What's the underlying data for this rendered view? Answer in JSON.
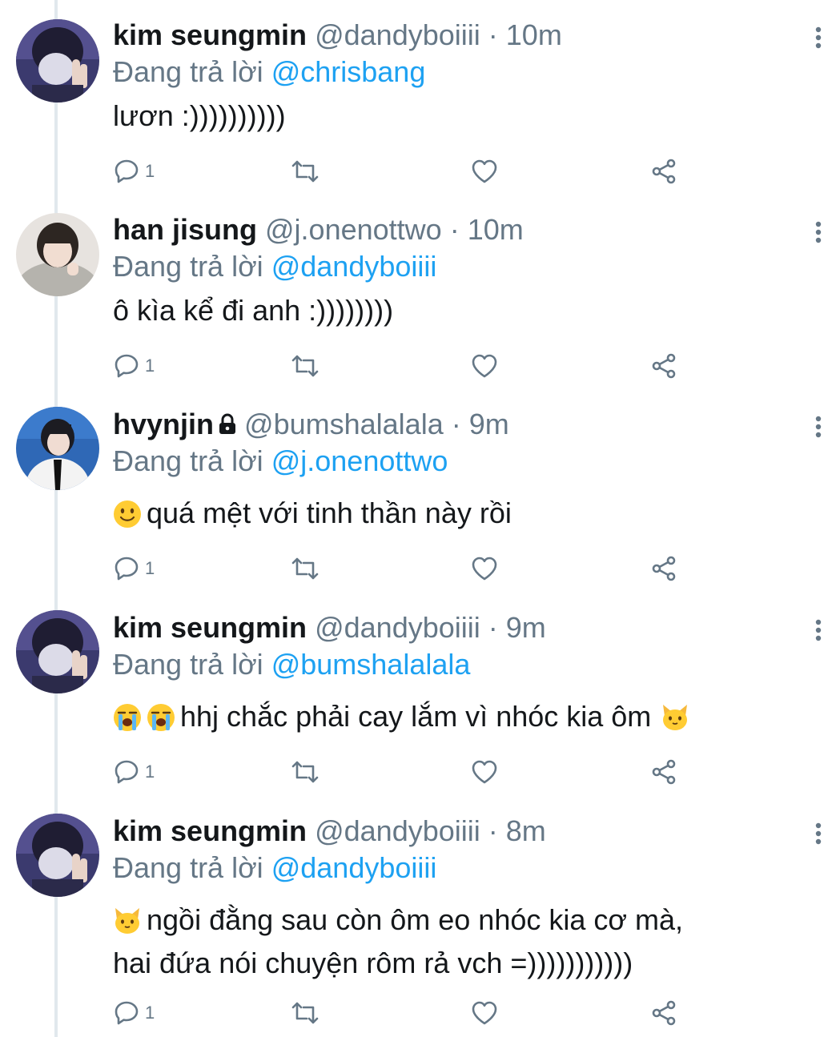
{
  "colors": {
    "link": "#1da1f2",
    "secondary_text": "#657786",
    "primary_text": "#14171a",
    "thread_line": "#e1e8ed"
  },
  "tweets": [
    {
      "name": "kim seungmin",
      "handle": "@dandyboiiii",
      "time": "10m",
      "reply_prefix": "Đang trả lời",
      "reply_to": "@chrisbang",
      "text_lines": [
        "lươn :))))))))))"
      ],
      "reply_count": "1",
      "locked": false,
      "avatar_icon": "avatar-masked-photo"
    },
    {
      "name": "han jisung",
      "handle": "@j.onenottwo",
      "time": "10m",
      "reply_prefix": "Đang trả lời",
      "reply_to": "@dandyboiiii",
      "text_lines": [
        "ô kìa kể đi anh :))))))))"
      ],
      "reply_count": "1",
      "locked": false,
      "avatar_icon": "avatar-hoodie-photo"
    },
    {
      "name": "hvynjin",
      "handle": "@bumshalalala",
      "time": "9m",
      "reply_prefix": "Đang trả lời",
      "reply_to": "@j.onenottwo",
      "text_lines": [
        "quá mệt với tinh thần này rồi"
      ],
      "emoji_prefix": "slightly-smiling-face",
      "reply_count": "1",
      "locked": true,
      "avatar_icon": "avatar-suit-photo"
    },
    {
      "name": "kim seungmin",
      "handle": "@dandyboiiii",
      "time": "9m",
      "reply_prefix": "Đang trả lời",
      "reply_to": "@bumshalalala",
      "text_lines": [
        "hhj chắc phải cay lắm vì nhóc kia ôm"
      ],
      "emoji_prefix": "loudly-crying-face x2",
      "emoji_suffix": "cat-face",
      "reply_count": "1",
      "locked": false,
      "avatar_icon": "avatar-masked-photo"
    },
    {
      "name": "kim seungmin",
      "handle": "@dandyboiiii",
      "time": "8m",
      "reply_prefix": "Đang trả lời",
      "reply_to": "@dandyboiiii",
      "text_lines": [
        "ngồi đằng sau còn ôm eo nhóc kia cơ mà,",
        "hai đứa nói chuyện rôm rả vch =)))))))))))"
      ],
      "emoji_prefix": "cat-face",
      "reply_count": "1",
      "locked": false,
      "avatar_icon": "avatar-masked-photo"
    }
  ],
  "separator": "·"
}
